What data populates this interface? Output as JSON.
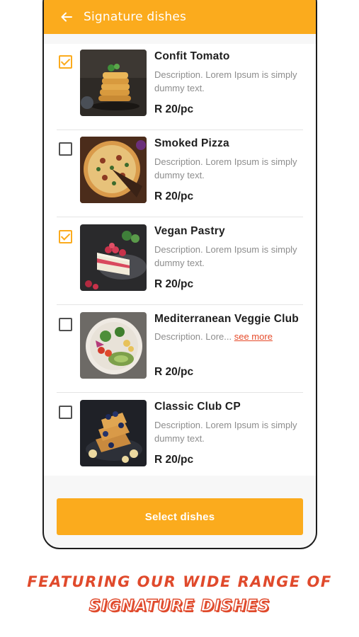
{
  "header": {
    "title": "Signature dishes",
    "back_icon": "arrow-left-icon"
  },
  "dishes": [
    {
      "name": "Confit Tomato",
      "description": "Description. Lorem Ipsum is simply dummy text.",
      "price": "R 20/pc",
      "checked": true,
      "image": "pancake-stack"
    },
    {
      "name": "Smoked Pizza",
      "description": "Description. Lorem Ipsum is simply dummy text.",
      "price": "R 20/pc",
      "checked": false,
      "image": "pizza"
    },
    {
      "name": "Vegan Pastry",
      "description": "Description. Lorem Ipsum is simply dummy text.",
      "price": "R 20/pc",
      "checked": true,
      "image": "layer-cake"
    },
    {
      "name": "Mediterranean Veggie Club",
      "description": "Description. Lore...",
      "see_more": "see more",
      "price": "R 20/pc",
      "checked": false,
      "image": "salad-bowl"
    },
    {
      "name": "Classic Club CP",
      "description": "Description. Lorem Ipsum is simply dummy text.",
      "price": "R 20/pc",
      "checked": false,
      "image": "french-toast"
    }
  ],
  "footer": {
    "button_label": "Select dishes"
  },
  "tagline": {
    "line1": "FEATURING OUR WIDE RANGE OF",
    "line2": "SIGNATURE DISHES"
  },
  "colors": {
    "accent": "#fbab1d",
    "tagline": "#e04a2c",
    "link": "#e64b2a"
  }
}
